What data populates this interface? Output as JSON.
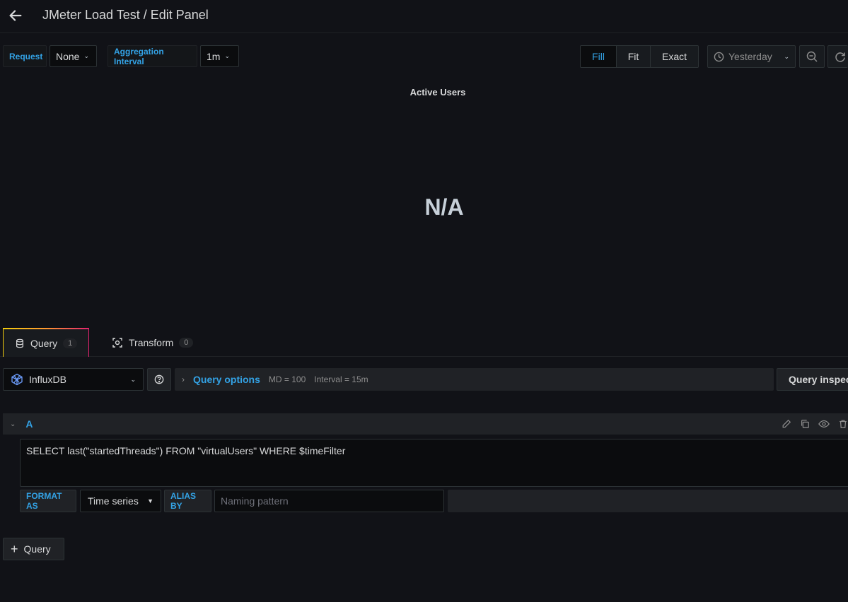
{
  "header": {
    "title": "JMeter Load Test / Edit Panel",
    "back_icon": "arrow-left-icon"
  },
  "variables": [
    {
      "label": "Request",
      "value": "None"
    },
    {
      "label": "Aggregation Interval",
      "value": "1m"
    }
  ],
  "toolbar": {
    "fit_modes": [
      {
        "label": "Fill",
        "active": true
      },
      {
        "label": "Fit",
        "active": false
      },
      {
        "label": "Exact",
        "active": false
      }
    ],
    "time_range": "Yesterday",
    "zoom_icon": "zoom-out-icon",
    "refresh_icon": "refresh-icon"
  },
  "panel": {
    "title": "Active Users",
    "value": "N/A"
  },
  "tabs": [
    {
      "label": "Query",
      "count": "1",
      "icon": "database-icon",
      "active": true
    },
    {
      "label": "Transform",
      "count": "0",
      "icon": "transform-icon",
      "active": false
    }
  ],
  "datasource": {
    "name": "InfluxDB",
    "query_options_label": "Query options",
    "md": "MD = 100",
    "interval": "Interval = 15m",
    "inspector_label": "Query inspector"
  },
  "query": {
    "ref_id": "A",
    "text": "SELECT last(\"startedThreads\") FROM \"virtualUsers\" WHERE $timeFilter",
    "format_label": "FORMAT AS",
    "format_value": "Time series",
    "alias_label": "ALIAS BY",
    "alias_placeholder": "Naming pattern",
    "alias_value": ""
  },
  "add_query_label": "Query",
  "colors": {
    "background": "#111217",
    "accent": "#33a2e5",
    "panel": "#202226"
  }
}
